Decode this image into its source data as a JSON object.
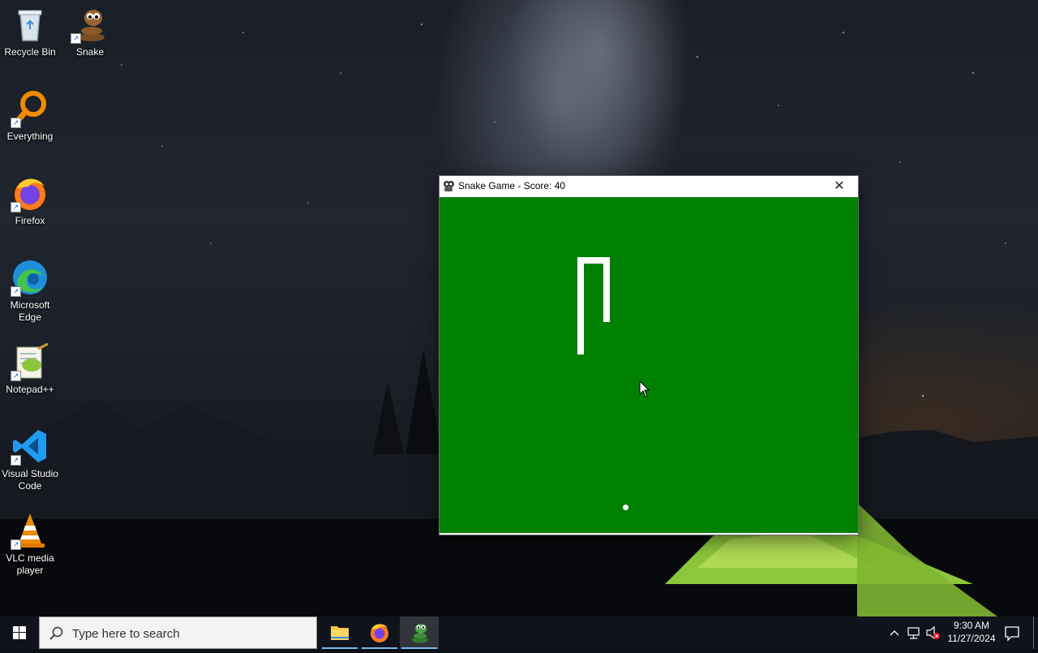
{
  "desktop": {
    "icons": [
      {
        "label": "Recycle Bin"
      },
      {
        "label": "Snake"
      },
      {
        "label": "Everything"
      },
      {
        "label": "Firefox"
      },
      {
        "label": "Microsoft Edge"
      },
      {
        "label": "Notepad++"
      },
      {
        "label": "Visual Studio Code"
      },
      {
        "label": "VLC media player"
      }
    ]
  },
  "window": {
    "title": "Snake Game - Score: 40",
    "close_label": "✕"
  },
  "game": {
    "background_color": "#008000",
    "snake_color": "#ffffff",
    "score": 40
  },
  "taskbar": {
    "search_placeholder": "Type here to search",
    "apps": [
      "File Explorer",
      "Firefox",
      "Snake Game"
    ],
    "active_app": "Snake Game",
    "time": "9:30 AM",
    "date": "11/27/2024"
  }
}
